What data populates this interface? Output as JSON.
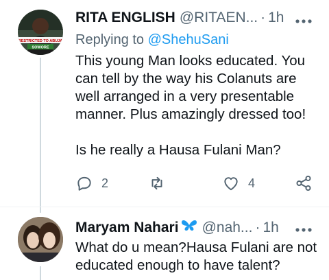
{
  "tweet1": {
    "name": "RITA ENGLISH",
    "handle": "@RITAEN...",
    "dot": "·",
    "time": "1h",
    "more_icon": "more-icon",
    "replying_prefix": "Replying to ",
    "replying_user": "@ShehuSani",
    "text": "This young Man looks educated. You can tell by the way his Colanuts are well arranged in a very presentable manner. Plus amazingly dressed too!\n\nIs he really a Hausa Fulani Man?",
    "avatar_caption_1": "RESTRICTED TO ABUJA",
    "avatar_caption_2": "SOWORE",
    "reply_count": "2",
    "retweet_count": "",
    "like_count": "4"
  },
  "tweet2": {
    "name": "Maryam Nahari",
    "handle": "@nah...",
    "dot": "·",
    "time": "1h",
    "text": "What do u mean?Hausa Fulani are not educated enough to have talent?"
  },
  "colors": {
    "accent": "#1d9bf0",
    "secondary_text": "#536471",
    "primary_text": "#0f1419",
    "thread_line": "#cfd9de"
  }
}
